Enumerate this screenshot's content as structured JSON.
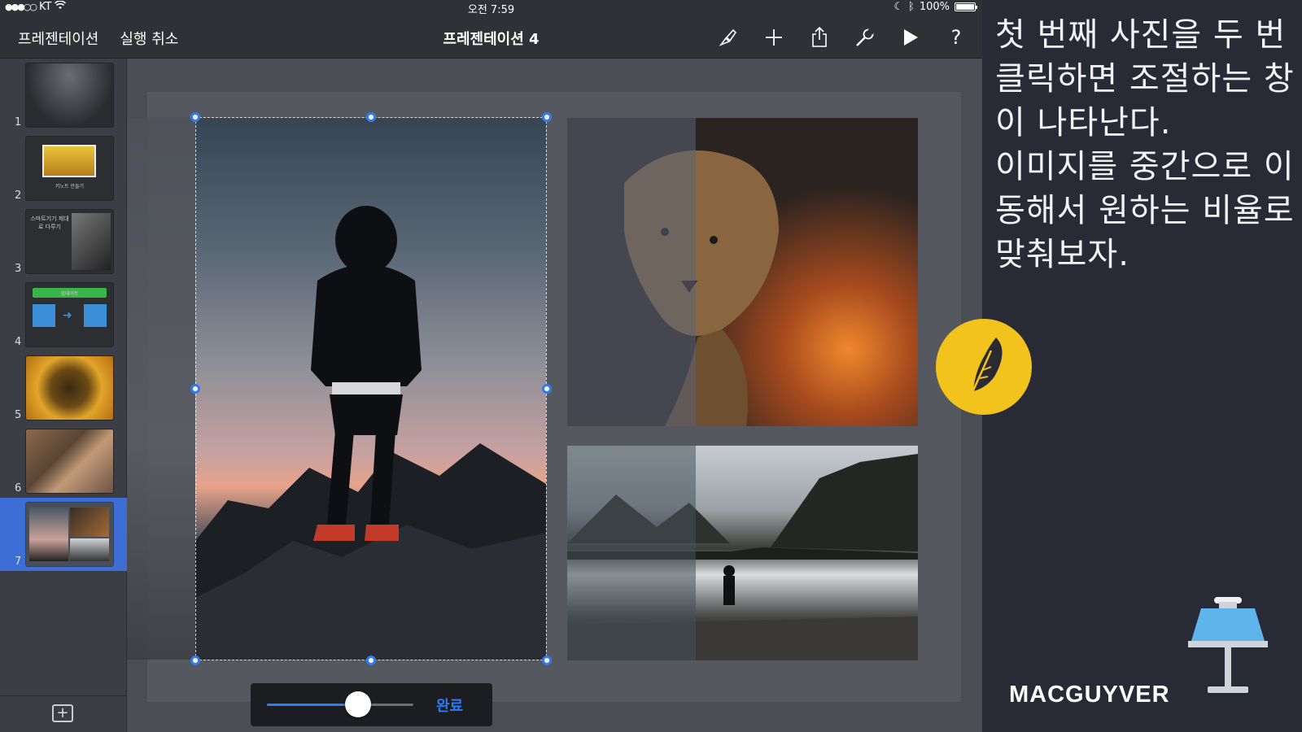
{
  "status_bar": {
    "carrier": "KT",
    "time": "오전 7:59",
    "battery": "100%"
  },
  "toolbar": {
    "presentations_label": "프레젠테이션",
    "undo_label": "실행 취소",
    "document_title": "프레젠테이션 4",
    "icons": [
      "format-brush-icon",
      "add-icon",
      "share-icon",
      "tools-wrench-icon",
      "play-icon",
      "help-icon"
    ],
    "help_label": "?"
  },
  "navigator": {
    "slides": [
      {
        "number": "1",
        "caption": ""
      },
      {
        "number": "2",
        "caption": "키노트 만들기"
      },
      {
        "number": "3",
        "caption": "스마트기기 제대로 다루기"
      },
      {
        "number": "4",
        "caption": "업데이트"
      },
      {
        "number": "5",
        "caption": ""
      },
      {
        "number": "6",
        "caption": ""
      },
      {
        "number": "7",
        "caption": ""
      }
    ],
    "selected_slide": "7",
    "add_label": "+"
  },
  "mask_editor": {
    "slider_value": 0.62,
    "done_label": "완료"
  },
  "caption": {
    "text": "첫 번째 사진을 두 번 클릭하면 조절하는 창이 나타난다.\n이미지를 중간으로 이동해서 원하는 비율로 맞춰보자."
  },
  "brand": {
    "name": "MACGUYVER"
  },
  "colors": {
    "accent": "#2f7bf5",
    "badge": "#f1c31c",
    "panel": "#282a36"
  }
}
